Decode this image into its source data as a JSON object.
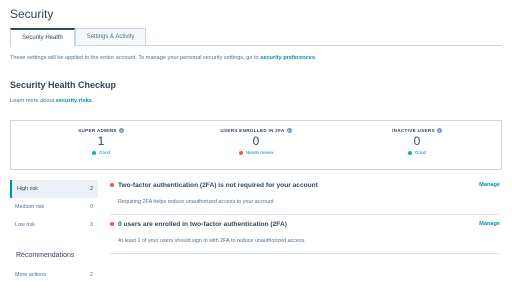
{
  "page": {
    "title": "Security"
  },
  "tabs": [
    {
      "label": "Security Health",
      "active": true
    },
    {
      "label": "Settings & Activity",
      "active": false
    }
  ],
  "description": {
    "text": "These settings will be applied to the entire account. To manage your personal security settings, go to ",
    "link": "security preferences",
    "suffix": "."
  },
  "checkup": {
    "title": "Security Health Checkup",
    "learn_text": "Learn more about ",
    "learn_link": "security risks",
    "learn_suffix": " ."
  },
  "stats": [
    {
      "label": "SUPER ADMINS",
      "value": "1",
      "status": "Good",
      "status_color": "#00bda5"
    },
    {
      "label": "USERS ENROLLED IN 2FA",
      "value": "0",
      "status": "Needs review",
      "status_color": "#f2545b"
    },
    {
      "label": "INACTIVE USERS",
      "value": "0",
      "status": "Good",
      "status_color": "#00bda5"
    }
  ],
  "sidebar": {
    "items": [
      {
        "label": "High risk",
        "count": "2",
        "active": true
      },
      {
        "label": "Medium risk",
        "count": "0",
        "active": false
      },
      {
        "label": "Low risk",
        "count": "3",
        "active": false
      }
    ],
    "recommendations_heading": "Recommendations",
    "more": {
      "label": "More actions",
      "count": "2"
    }
  },
  "issues": [
    {
      "title": "Two-factor authentication (2FA) is not required for your account",
      "subtitle": "Requiring 2FA helps reduce unauthorized access to your account.",
      "action": "Manage"
    },
    {
      "title": "0 users are enrolled in two-factor authentication (2FA)",
      "subtitle": "At least 1 of your users should sign in with 2FA to reduce unauthorized access.",
      "action": "Manage"
    }
  ],
  "icons": {
    "info": "info-icon",
    "status_dot": "status-dot-icon"
  },
  "colors": {
    "accent": "#0091ae",
    "danger": "#f2545b",
    "success": "#00bda5",
    "text": "#33475b"
  }
}
